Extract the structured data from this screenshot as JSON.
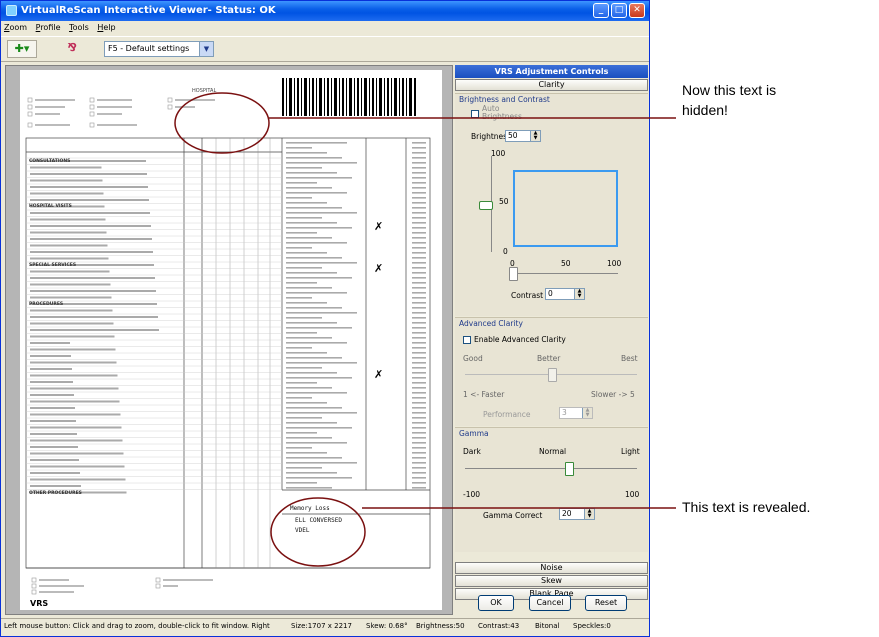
{
  "window": {
    "title": "VirtualReScan Interactive Viewer- Status: OK",
    "minimize": "_",
    "maximize": "□",
    "close": "✕"
  },
  "menu": [
    "Zoom",
    "Profile",
    "Tools",
    "Help"
  ],
  "toolbar": {
    "zoom_icon": "zoom-fit-icon",
    "profile_icon": "vrs-profile-icon",
    "profile_select": "F5 - Default settings"
  },
  "document": {
    "hospital_label": "HOSPITAL",
    "section_consultations": "CONSULTATIONS",
    "section_hospital_visits": "HOSPITAL VISITS",
    "section_special_services": "SPECIAL SERVICES",
    "section_procedures": "PROCEDURES",
    "section_other": "OTHER PROCEDURES",
    "revealed_text_1": "Memory Loss",
    "revealed_text_2": "ELL CONVERSED",
    "revealed_text_3": "VDEL",
    "logo": "VRS"
  },
  "panel": {
    "header": "VRS Adjustment Controls",
    "clarity_tab": "Clarity",
    "brightness_contrast_title": "Brightness and Contrast",
    "auto_brightness_label": "Auto Brightness",
    "brightness_label": "Brightness",
    "brightness_value": "50",
    "graph_y_100": "100",
    "graph_y_50": "50",
    "graph_y_0": "0",
    "graph_x_0": "0",
    "graph_x_50": "50",
    "graph_x_100": "100",
    "contrast_label": "Contrast",
    "contrast_value": "0",
    "advanced_clarity_title": "Advanced Clarity",
    "enable_advanced_label": "Enable Advanced Clarity",
    "good_label": "Good",
    "better_label": "Better",
    "best_label": "Best",
    "faster_label": "1 <- Faster",
    "slower_label": "Slower -> 5",
    "performance_label": "Performance",
    "performance_value": "3",
    "gamma_title": "Gamma",
    "dark_label": "Dark",
    "normal_label": "Normal",
    "light_label": "Light",
    "gamma_min": "-100",
    "gamma_max": "100",
    "gamma_correct_label": "Gamma Correct",
    "gamma_value": "20",
    "noise_button": "Noise",
    "skew_button": "Skew",
    "blank_page_button": "Blank Page",
    "ok_button": "OK",
    "cancel_button": "Cancel",
    "reset_button": "Reset"
  },
  "slider_levels": {
    "brightness_vertical": 0.5,
    "advanced_clarity": 0.5,
    "gamma": 0.6
  },
  "status": {
    "hint": "Left mouse button: Click and drag to zoom, double-click to fit window. Right",
    "size": "Size:1707 x 2217",
    "skew": "Skew: 0.68°",
    "brightness": "Brightness:50",
    "contrast": "Contrast:43",
    "mode": "Bitonal",
    "speckles": "Speckles:0"
  },
  "annotations": {
    "top": "Now this text is hidden!",
    "top_line1": "Now this text is",
    "top_line2": "hidden!",
    "bottom": "This text is revealed."
  },
  "colors": {
    "title_blue": "#0054e3",
    "panel_header": "#1a4fc0",
    "graph_box": "#3b9af0",
    "annotation_ellipse": "#7a1010"
  }
}
